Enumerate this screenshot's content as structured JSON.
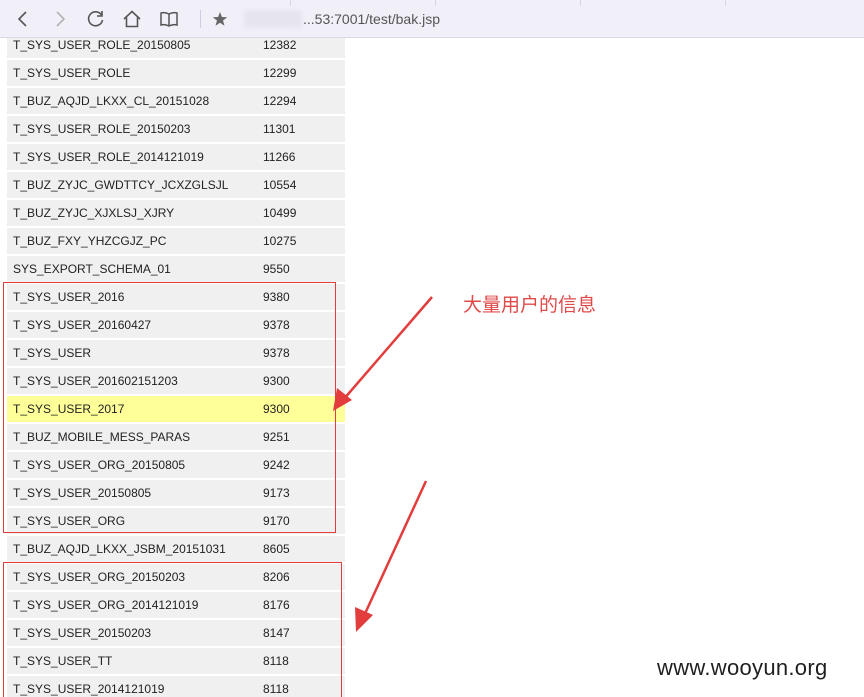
{
  "browser": {
    "url_visible": "...53:7001/test/bak.jsp",
    "icons": [
      "back-icon",
      "forward-icon",
      "refresh-icon",
      "home-icon",
      "reading-view-icon",
      "favorite-star-icon"
    ]
  },
  "table": {
    "rows": [
      {
        "name": "T_SYS_USER_ROLE_20150805",
        "count": "12382"
      },
      {
        "name": "T_SYS_USER_ROLE",
        "count": "12299"
      },
      {
        "name": "T_BUZ_AQJD_LKXX_CL_20151028",
        "count": "12294"
      },
      {
        "name": "T_SYS_USER_ROLE_20150203",
        "count": "11301"
      },
      {
        "name": "T_SYS_USER_ROLE_2014121019",
        "count": "11266"
      },
      {
        "name": "T_BUZ_ZYJC_GWDTTCY_JCXZGLSJL",
        "count": "10554"
      },
      {
        "name": "T_BUZ_ZYJC_XJXLSJ_XJRY",
        "count": "10499"
      },
      {
        "name": "T_BUZ_FXY_YHZCGJZ_PC",
        "count": "10275"
      },
      {
        "name": "SYS_EXPORT_SCHEMA_01",
        "count": "9550"
      },
      {
        "name": "T_SYS_USER_2016",
        "count": "9380"
      },
      {
        "name": "T_SYS_USER_20160427",
        "count": "9378"
      },
      {
        "name": "T_SYS_USER",
        "count": "9378"
      },
      {
        "name": "T_SYS_USER_201602151203",
        "count": "9300"
      },
      {
        "name": "T_SYS_USER_2017",
        "count": "9300"
      },
      {
        "name": "T_BUZ_MOBILE_MESS_PARAS",
        "count": "9251"
      },
      {
        "name": "T_SYS_USER_ORG_20150805",
        "count": "9242"
      },
      {
        "name": "T_SYS_USER_20150805",
        "count": "9173"
      },
      {
        "name": "T_SYS_USER_ORG",
        "count": "9170"
      },
      {
        "name": "T_BUZ_AQJD_LKXX_JSBM_20151031",
        "count": "8605"
      },
      {
        "name": "T_SYS_USER_ORG_20150203",
        "count": "8206"
      },
      {
        "name": "T_SYS_USER_ORG_2014121019",
        "count": "8176"
      },
      {
        "name": "T_SYS_USER_20150203",
        "count": "8147"
      },
      {
        "name": "T_SYS_USER_TT",
        "count": "8118"
      },
      {
        "name": "T_SYS_USER_2014121019",
        "count": "8118"
      }
    ],
    "highlighted_row": "T_SYS_USER_2017",
    "highlight_color": "#ffff99"
  },
  "annotation": {
    "text": "大量用户的信息",
    "color": "#e24a4a"
  },
  "watermark": "www.wooyun.org"
}
